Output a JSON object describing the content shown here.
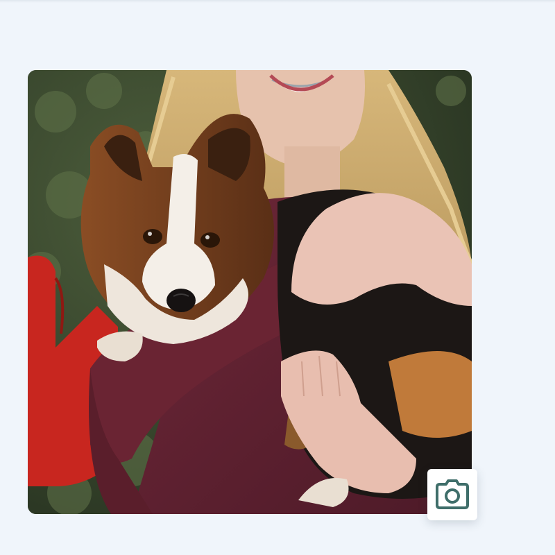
{
  "photo": {
    "subject": "smiling-person-holding-dog"
  },
  "camera_button": {
    "icon": "camera-icon",
    "icon_color": "#3f6e6a"
  },
  "colors": {
    "page_background": "#f0f5fb"
  }
}
